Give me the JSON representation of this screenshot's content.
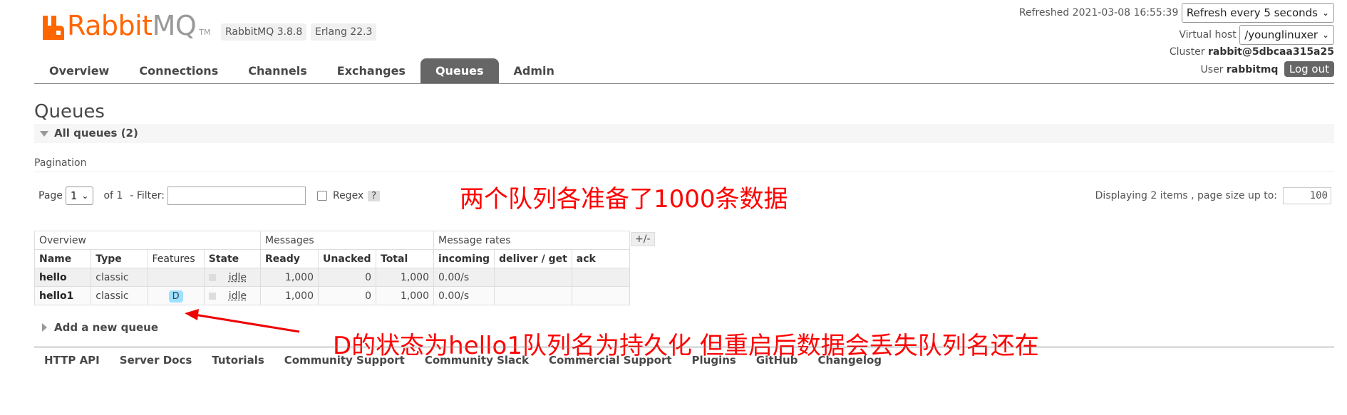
{
  "header": {
    "logo_rabbit": "Rabbit",
    "logo_mq": "MQ",
    "logo_tm": "TM",
    "version_rabbitmq": "RabbitMQ 3.8.8",
    "version_erlang": "Erlang 22.3",
    "refreshed_label": "Refreshed 2021-03-08 16:55:39",
    "refresh_select": "Refresh every 5 seconds",
    "vhost_label": "Virtual host",
    "vhost_select": "/younglinuxer",
    "cluster_label": "Cluster",
    "cluster_name": "rabbit@5dbcaa315a25",
    "user_label": "User",
    "user_name": "rabbitmq",
    "logout_label": "Log out"
  },
  "tabs": [
    {
      "label": "Overview"
    },
    {
      "label": "Connections"
    },
    {
      "label": "Channels"
    },
    {
      "label": "Exchanges"
    },
    {
      "label": "Queues",
      "active": true
    },
    {
      "label": "Admin"
    }
  ],
  "page": {
    "title": "Queues",
    "section_title": "All queues (2)",
    "pagination_label": "Pagination",
    "page_label": "Page",
    "page_value": "1",
    "of_label": "of 1",
    "filter_label": "- Filter:",
    "filter_value": "",
    "regex_label": "Regex",
    "regex_help": "?",
    "displaying_label": "Displaying 2 items , page size up to:",
    "page_size": "100",
    "add_queue_label": "Add a new queue",
    "plusminus_label": "+/-"
  },
  "annotations": {
    "top": "两个队列各准备了1000条数据",
    "bottom": "D的状态为hello1队列名为持久化 但重启后数据会丢失队列名还在"
  },
  "table": {
    "groups": [
      "Overview",
      "Messages",
      "Message rates"
    ],
    "columns": [
      "Name",
      "Type",
      "Features",
      "State",
      "Ready",
      "Unacked",
      "Total",
      "incoming",
      "deliver / get",
      "ack"
    ],
    "rows": [
      {
        "name": "hello",
        "type": "classic",
        "feature": "",
        "state": "idle",
        "ready": "1,000",
        "unacked": "0",
        "total": "1,000",
        "incoming": "0.00/s",
        "deliver": "",
        "ack": ""
      },
      {
        "name": "hello1",
        "type": "classic",
        "feature": "D",
        "state": "idle",
        "ready": "1,000",
        "unacked": "0",
        "total": "1,000",
        "incoming": "0.00/s",
        "deliver": "",
        "ack": ""
      }
    ]
  },
  "footer": [
    "HTTP API",
    "Server Docs",
    "Tutorials",
    "Community Support",
    "Community Slack",
    "Commercial Support",
    "Plugins",
    "GitHub",
    "Changelog"
  ],
  "colors": {
    "brand": "#ff6600",
    "active_tab": "#666666",
    "annotation": "#ff0000",
    "feature_badge": "#9ee0ff"
  }
}
